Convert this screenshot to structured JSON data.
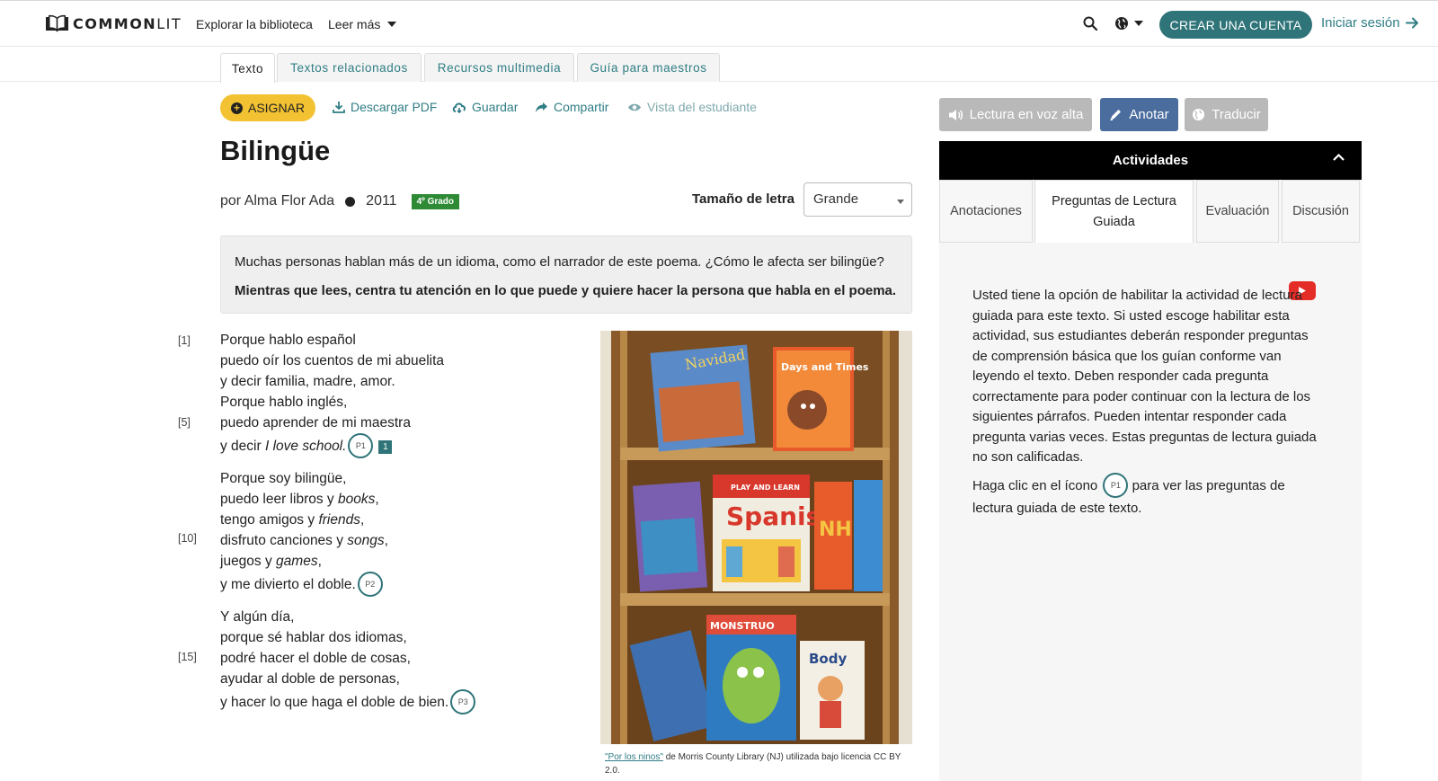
{
  "nav": {
    "logo_text_bold": "COMMON",
    "logo_text_light": "LIT",
    "explore": "Explorar la biblioteca",
    "read_more": "Leer más",
    "create_account": "CREAR UNA CUENTA",
    "login": "Iniciar sesión"
  },
  "tabs": [
    "Texto",
    "Textos relacionados",
    "Recursos multimedia",
    "Guía para maestros"
  ],
  "actions": {
    "assign": "ASIGNAR",
    "download": "Descargar PDF",
    "save": "Guardar",
    "share": "Compartir",
    "student_view": "Vista del estudiante"
  },
  "text": {
    "title": "Bilingüe",
    "author": "por Alma Flor Ada",
    "year": "2011",
    "grade": "4º Grado",
    "font_size_label": "Tamaño de letra",
    "font_size_value": "Grande"
  },
  "intro": {
    "line1": "Muchas personas hablan más de un idioma, como el narrador de este poema. ¿Cómo le afecta ser bilingüe?",
    "line2": "Mientras que lees, centra tu atención en lo que puede y quiere hacer la persona que habla en el poema."
  },
  "poem": {
    "l1": "Porque hablo español",
    "l2": "puedo oír los cuentos de mi abuelita",
    "l3": "y decir familia, madre, amor.",
    "l4": "Porque hablo inglés,",
    "l5": "puedo aprender de mi maestra",
    "l6a": "y decir ",
    "l6b": "I love school.",
    "l7": "Porque soy bilingüe,",
    "l8a": "puedo leer libros y ",
    "l8b": "books",
    "l8c": ",",
    "l9a": "tengo amigos y ",
    "l9b": "friends",
    "l9c": ",",
    "l10a": "disfruto canciones y ",
    "l10b": "songs",
    "l10c": ",",
    "l11a": "juegos y ",
    "l11b": "games",
    "l11c": ",",
    "l12": "y me divierto el doble.",
    "l13": "Y algún día,",
    "l14": "porque sé hablar dos idiomas,",
    "l15": "podré hacer el doble de cosas,",
    "l16": "ayudar al doble de personas,",
    "l17": "y hacer lo que haga el doble de bien.",
    "n1": "[1]",
    "n5": "[5]",
    "n10": "[10]",
    "n15": "[15]",
    "p1": "P1",
    "p2": "P2",
    "p3": "P3",
    "footnote": "1"
  },
  "image": {
    "book1": "Navidad",
    "book2": "Days and Times",
    "book3": "Spanish",
    "book3_top": "PLAY AND LEARN",
    "book4": "NH",
    "book5": "Body",
    "book6": "MONSTRUO",
    "caption_link": "\"Por los ninos\"",
    "caption_rest": " de Morris County Library (NJ) utilizada bajo licencia CC BY 2.0."
  },
  "panel": {
    "read_aloud": "Lectura en voz alta",
    "annotate": "Anotar",
    "translate": "Traducir",
    "activities": "Actividades",
    "tabs": [
      "Anotaciones",
      "Preguntas de Lectura Guiada",
      "Evaluación",
      "Discusión"
    ],
    "p1": "Usted tiene la opción de habilitar la actividad de lectura guiada para este texto. Si usted escoge habilitar esta actividad, sus estudiantes deberán responder preguntas de comprensión básica que los guían conforme van leyendo el texto. Deben responder cada pregunta correctamente para poder continuar con la lectura de los siguientes párrafos. Pueden intentar responder cada pregunta varias veces. Estas preguntas de lectura guiada no son calificadas.",
    "p2a": "Haga clic en el ícono",
    "p2b": "para ver las preguntas de lectura guiada de este texto.",
    "badge": "P1"
  },
  "colors": {
    "brand_teal": "#2f7479",
    "link_teal": "#2f7d84",
    "assign_yellow": "#f2c232",
    "grade_green": "#2f8a36",
    "annotate_blue": "#4a6d9e",
    "youtube_red": "#e52d27"
  },
  "icons": [
    "book-logo-icon",
    "search-icon",
    "globe-icon",
    "arrow-right-icon",
    "plus-icon",
    "download-icon",
    "save-icon",
    "share-icon",
    "eye-icon",
    "speaker-icon",
    "pencil-icon",
    "globe-translate-icon",
    "chevron-up-icon",
    "youtube-icon"
  ]
}
